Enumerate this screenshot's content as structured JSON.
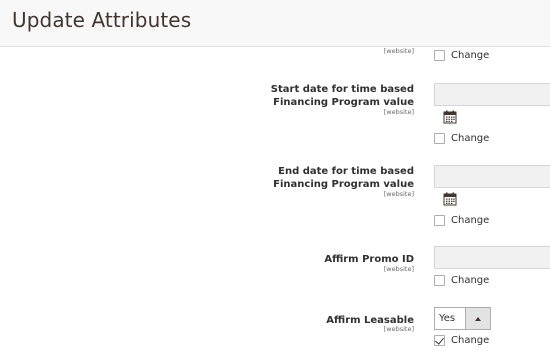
{
  "header": {
    "title": "Update Attributes"
  },
  "scope_text": "[website]",
  "change_label": "Change",
  "rows": [
    {
      "label_line1": "",
      "label_line2": "",
      "scope": "[website]",
      "change": "Change",
      "checked": false
    },
    {
      "label_line1": "Start date for time based",
      "label_line2": "Financing Program value",
      "scope": "[website]",
      "change": "Change",
      "checked": false
    },
    {
      "label_line1": "End date for time based",
      "label_line2": "Financing Program value",
      "scope": "[website]",
      "change": "Change",
      "checked": false
    },
    {
      "label_line1": "Affirm Promo ID",
      "scope": "[website]",
      "change": "Change",
      "checked": false
    },
    {
      "label_line1": "Affirm Leasable",
      "scope": "[website]",
      "change": "Change",
      "checked": true,
      "select_value": "Yes"
    }
  ],
  "icons": {
    "calendar": "calendar-icon",
    "select_arrow": "chevron-up-icon",
    "checkmark": "checkmark-icon"
  },
  "colors": {
    "header_bg": "#f8f8f8",
    "field_bg": "#f1f1f1",
    "text": "#303030"
  }
}
